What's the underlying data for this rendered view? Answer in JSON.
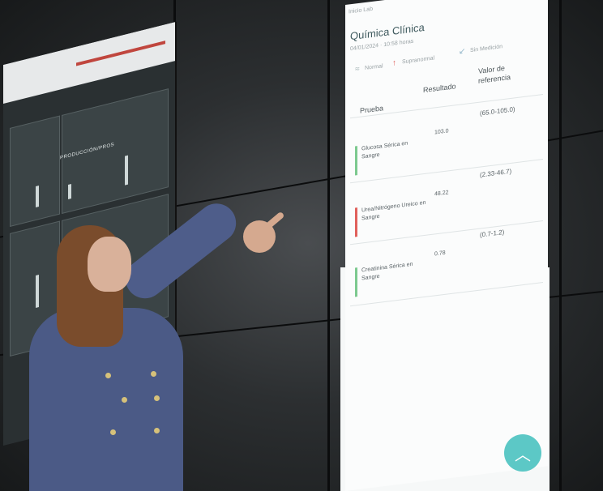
{
  "report": {
    "header_small": "Inicio  Lab",
    "title": "Química Clínica",
    "date": "04/01/2024 · 10:58 horas",
    "legend": {
      "normal": "Normal",
      "supranormal": "Supranormal",
      "sin_medicion": "Sin Medición"
    },
    "columns": {
      "prueba": "Prueba",
      "resultado": "Resultado",
      "referencia": "Valor de referencia"
    },
    "rows": [
      {
        "prueba": "Glucosa Sérica en Sangre",
        "resultado": "103.0",
        "referencia": "(65.0-105.0)",
        "status_color": "#7cc98f"
      },
      {
        "prueba": "Urea/Nitrógeno Ureico en Sangre",
        "resultado": "48.22",
        "referencia": "(2.33-46.7)",
        "status_color": "#e0605c"
      },
      {
        "prueba": "Creatinina Sérica en Sangre",
        "resultado": "0.78",
        "referencia": "(0.7-1.2)",
        "status_color": "#7cc98f"
      }
    ],
    "fab_icon": "chevron-up-icon"
  },
  "dashboard": {
    "title": "PRODUCCIÓN/PROS"
  }
}
